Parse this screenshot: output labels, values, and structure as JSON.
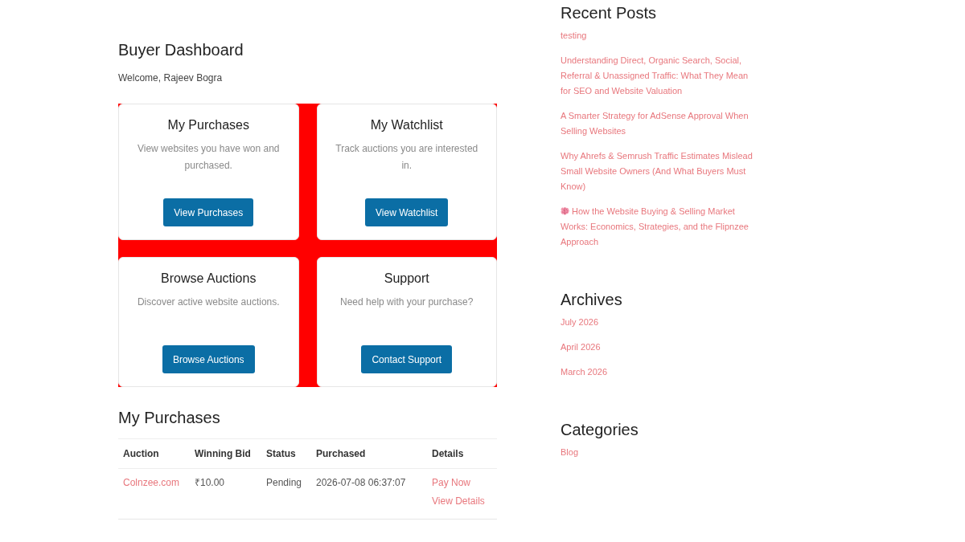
{
  "dashboard": {
    "title": "Buyer Dashboard",
    "welcome": "Welcome, Rajeev Bogra",
    "cards": [
      {
        "title": "My Purchases",
        "description": "View websites you have won and purchased.",
        "button": "View Purchases"
      },
      {
        "title": "My Watchlist",
        "description": "Track auctions you are interested in.",
        "button": "View Watchlist"
      },
      {
        "title": "Browse Auctions",
        "description": "Discover active website auctions.",
        "button": "Browse Auctions"
      },
      {
        "title": "Support",
        "description": "Need help with your purchase?",
        "button": "Contact Support"
      }
    ]
  },
  "purchases": {
    "title": "My Purchases",
    "columns": [
      "Auction",
      "Winning Bid",
      "Status",
      "Purchased",
      "Details"
    ],
    "rows": [
      {
        "cells": [
          {
            "kind": "link",
            "text": "Colnzee.com"
          },
          {
            "kind": "text",
            "text": "₹10.00"
          },
          {
            "kind": "text",
            "text": "Pending"
          },
          {
            "kind": "text",
            "text": "2026-07-08 06:37:07"
          },
          {
            "kind": "links",
            "links": [
              "Pay Now",
              "View Details"
            ]
          }
        ]
      }
    ]
  },
  "sidebar": {
    "widgets": [
      {
        "title": "Recent Posts",
        "items": [
          {
            "kind": "link",
            "text": "testing"
          },
          {
            "kind": "link",
            "text": "Understanding Direct, Organic Search, Social, Referral & Unassigned Traffic: What They Mean for SEO and Website Valuation"
          },
          {
            "kind": "link",
            "text": "A Smarter Strategy for AdSense Approval When Selling Websites"
          },
          {
            "kind": "link",
            "text": "Why Ahrefs & Semrush Traffic Estimates Mislead Small Website Owners (And What Buyers Must Know)"
          },
          {
            "kind": "icon-link",
            "text": "How the Website Buying & Selling Market Works: Economics, Strategies, and the Flipnzee Approach"
          }
        ]
      },
      {
        "title": "Archives",
        "items": [
          {
            "kind": "link",
            "text": "July 2026"
          },
          {
            "kind": "link",
            "text": "April 2026"
          },
          {
            "kind": "link",
            "text": "March 2026"
          }
        ]
      },
      {
        "title": "Categories",
        "items": [
          {
            "kind": "link",
            "text": "Blog"
          }
        ]
      }
    ]
  }
}
